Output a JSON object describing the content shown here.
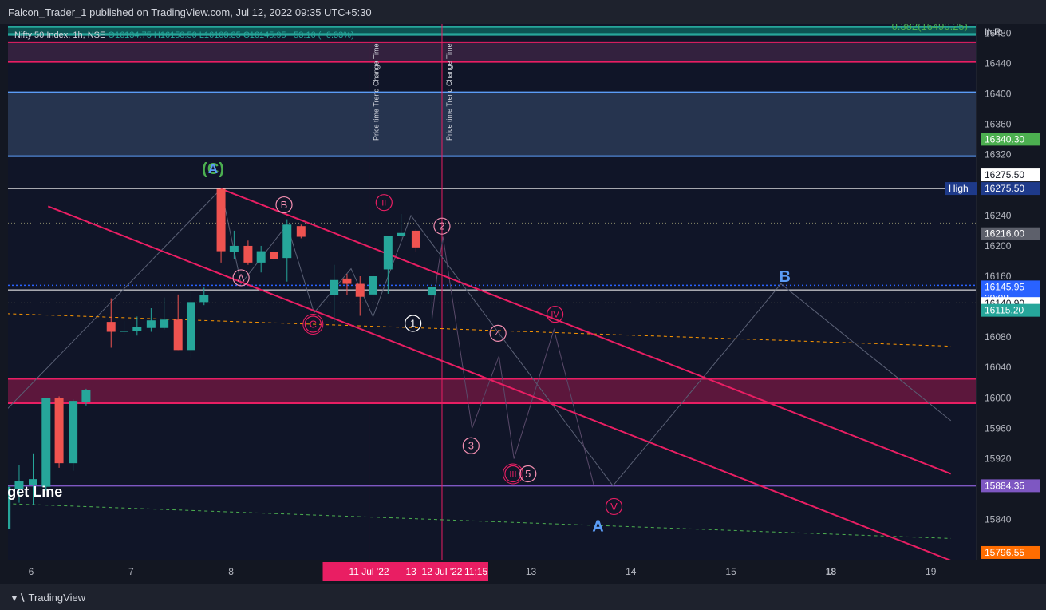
{
  "header": {
    "title": "Falcon_Trader_1 published on TradingView.com, Jul 12, 2022 09:35 UTC+5:30"
  },
  "footer": {
    "brand": "TradingView",
    "brand_icon": "tradingview-logo-icon"
  },
  "colors": {
    "bg": "#131722",
    "up": "#26a69a",
    "down": "#ef5350",
    "pink": "#e91e63",
    "blue_line": "#5b9cf6",
    "purple": "#7e57c2",
    "orange": "#ff9800",
    "green_label": "#4caf50"
  },
  "chart_data": {
    "type": "candlestick",
    "symbol_line": {
      "name": "Nifty 50 Index, 1h, NSE",
      "open": "O16134.75",
      "high": "H16150.50",
      "low": "L16103.35",
      "close": "C16145.95",
      "change": "−53.10 (−0.33%)"
    },
    "currency": "INR",
    "y_range": [
      15786,
      16492
    ],
    "y_ticks": [
      16480,
      16440,
      16400,
      16360,
      16320,
      16240,
      16200,
      16160,
      16080,
      16040,
      16000,
      15960,
      15920,
      15840
    ],
    "x_ticks": [
      {
        "label": "6",
        "x": 0.5
      },
      {
        "label": "7",
        "x": 1.5
      },
      {
        "label": "8",
        "x": 2.5
      },
      {
        "label": "11",
        "x": 3.5,
        "bold": true
      },
      {
        "label": "13",
        "x": 5.5
      },
      {
        "label": "14",
        "x": 6.5
      },
      {
        "label": "15",
        "x": 7.5
      },
      {
        "label": "18",
        "x": 8.5,
        "bold": true
      },
      {
        "label": "19",
        "x": 9.5
      }
    ],
    "x_highlight": [
      {
        "label": "11 Jul '22",
        "x": 3.88
      },
      {
        "label": "13",
        "x": 4.3
      },
      {
        "label": "12 Jul '22",
        "x": 4.61
      },
      {
        "label": "11:15",
        "x": 4.95
      }
    ],
    "candles": [
      {
        "x": 0.12,
        "o": 15806,
        "h": 15820,
        "l": 15790,
        "c": 15795
      },
      {
        "x": 0.25,
        "o": 15828,
        "h": 15897,
        "l": 15796,
        "c": 15883
      },
      {
        "x": 0.38,
        "o": 15880,
        "h": 15912,
        "l": 15862,
        "c": 15890
      },
      {
        "x": 0.52,
        "o": 15885,
        "h": 15927,
        "l": 15859,
        "c": 15893
      },
      {
        "x": 0.65,
        "o": 15883,
        "h": 16000,
        "l": 15878,
        "c": 16000
      },
      {
        "x": 0.78,
        "o": 16000,
        "h": 16002,
        "l": 15908,
        "c": 15914
      },
      {
        "x": 0.92,
        "o": 15914,
        "h": 15998,
        "l": 15904,
        "c": 15996
      },
      {
        "x": 1.05,
        "o": 15995,
        "h": 16012,
        "l": 15990,
        "c": 16010
      },
      {
        "x": 1.3,
        "o": 16100,
        "h": 16131,
        "l": 16066,
        "c": 16087
      },
      {
        "x": 1.43,
        "o": 16087,
        "h": 16101,
        "l": 16082,
        "c": 16088
      },
      {
        "x": 1.56,
        "o": 16088,
        "h": 16107,
        "l": 16082,
        "c": 16093
      },
      {
        "x": 1.7,
        "o": 16092,
        "h": 16118,
        "l": 16087,
        "c": 16102
      },
      {
        "x": 1.83,
        "o": 16092,
        "h": 16132,
        "l": 16090,
        "c": 16103
      },
      {
        "x": 1.97,
        "o": 16103,
        "h": 16136,
        "l": 16063,
        "c": 16063
      },
      {
        "x": 2.1,
        "o": 16063,
        "h": 16140,
        "l": 16052,
        "c": 16126
      },
      {
        "x": 2.23,
        "o": 16126,
        "h": 16145,
        "l": 16122,
        "c": 16135
      },
      {
        "x": 2.4,
        "o": 16275,
        "h": 16275,
        "l": 16178,
        "c": 16193
      },
      {
        "x": 2.53,
        "o": 16192,
        "h": 16220,
        "l": 16183,
        "c": 16200
      },
      {
        "x": 2.67,
        "o": 16200,
        "h": 16207,
        "l": 16175,
        "c": 16178
      },
      {
        "x": 2.8,
        "o": 16178,
        "h": 16200,
        "l": 16165,
        "c": 16193
      },
      {
        "x": 2.93,
        "o": 16192,
        "h": 16205,
        "l": 16180,
        "c": 16183
      },
      {
        "x": 3.06,
        "o": 16184,
        "h": 16235,
        "l": 16153,
        "c": 16228
      },
      {
        "x": 3.2,
        "o": 16226,
        "h": 16228,
        "l": 16210,
        "c": 16212
      },
      {
        "x": 3.53,
        "o": 16135,
        "h": 16175,
        "l": 16100,
        "c": 16155
      },
      {
        "x": 3.66,
        "o": 16157,
        "h": 16163,
        "l": 16135,
        "c": 16150
      },
      {
        "x": 3.79,
        "o": 16150,
        "h": 16160,
        "l": 16108,
        "c": 16133
      },
      {
        "x": 3.92,
        "o": 16136,
        "h": 16165,
        "l": 16107,
        "c": 16160
      },
      {
        "x": 4.07,
        "o": 16169,
        "h": 16213,
        "l": 16137,
        "c": 16213
      },
      {
        "x": 4.2,
        "o": 16213,
        "h": 16242,
        "l": 16210,
        "c": 16217
      },
      {
        "x": 4.35,
        "o": 16220,
        "h": 16222,
        "l": 16192,
        "c": 16198
      },
      {
        "x": 4.51,
        "o": 16134.75,
        "h": 16150.5,
        "l": 16103.35,
        "c": 16145.95
      }
    ],
    "price_labels": [
      {
        "value": 16340.3,
        "text": "16340.30",
        "bg": "#4caf50",
        "fg": "#ffffff"
      },
      {
        "value": 16275.5,
        "text": "16275.50",
        "bg": "#ffffff",
        "fg": "#131722",
        "offset": -17
      },
      {
        "value": 16275.5,
        "text": "16275.50",
        "bg": "#1e3a8a",
        "fg": "#ffffff",
        "tag": "High"
      },
      {
        "value": 16216.0,
        "text": "16216.00",
        "bg": "#5d606b",
        "fg": "#ffffff"
      },
      {
        "value": 16145.95,
        "text": "16145.95",
        "bg": "#2962ff",
        "fg": "#ffffff",
        "sub": "39:08"
      },
      {
        "value": 16140.9,
        "text": "16140.90",
        "bg": "#ffffff",
        "fg": "#131722",
        "offset": 16
      },
      {
        "value": 16115.2,
        "text": "16115.20",
        "bg": "#26a69a",
        "fg": "#ffffff"
      },
      {
        "value": 15884.35,
        "text": "15884.35",
        "bg": "#7e57c2",
        "fg": "#ffffff"
      },
      {
        "value": 15796.55,
        "text": "15796.55",
        "bg": "#ff6d00",
        "fg": "#ffffff"
      }
    ],
    "fib_label": "0.382(16490.25)",
    "fib_line": 16490.25,
    "zones": [
      {
        "top": 16488,
        "bottom": 16479,
        "fill": "#0d5e5a",
        "stroke": "#26a69a"
      },
      {
        "top": 16468,
        "bottom": 16442,
        "fill": "#3a2342",
        "stroke": "#e91e63"
      },
      {
        "top": 16402,
        "bottom": 16318,
        "fill": "#2a3a56",
        "stroke": "#5b9cf6"
      },
      {
        "top": 16025,
        "bottom": 15993,
        "fill": "#6a1740",
        "stroke": "#e91e63"
      }
    ],
    "hlines": [
      {
        "value": 16275.5,
        "color": "#ffffff",
        "dash": "",
        "width": 1
      },
      {
        "value": 16230,
        "color": "#8a8a6a",
        "dash": "1,3",
        "width": 1
      },
      {
        "value": 16148,
        "color": "#2962ff",
        "dash": "2,3",
        "width": 1.5
      },
      {
        "value": 16142,
        "color": "#ffffff",
        "dash": "",
        "width": 1
      },
      {
        "value": 16125,
        "color": "#8a8a6a",
        "dash": "1,3",
        "width": 1
      },
      {
        "value": 15884.35,
        "color": "#7e57c2",
        "dash": "",
        "width": 2
      }
    ],
    "diag_lines": [
      {
        "x1": 0.0,
        "y1": 16112,
        "x2": 9.7,
        "y2": 16068,
        "color": "#ff9800",
        "dash": "4,4",
        "width": 1
      },
      {
        "x1": 0.0,
        "y1": 15862,
        "x2": 9.7,
        "y2": 15815,
        "color": "#4caf50",
        "dash": "4,4",
        "width": 1
      },
      {
        "x1": 2.4,
        "y1": 16275,
        "x2": 9.7,
        "y2": 15900,
        "color": "#e91e63",
        "dash": "",
        "width": 2
      },
      {
        "x1": 0.67,
        "y1": 16252,
        "x2": 9.7,
        "y2": 15786,
        "color": "#e91e63",
        "dash": "",
        "width": 2
      }
    ],
    "paths": [
      {
        "color": "#5a6075",
        "points": [
          [
            0.0,
            15950
          ],
          [
            2.4,
            16275
          ],
          [
            2.6,
            16150
          ],
          [
            3.06,
            16228
          ],
          [
            3.33,
            16112
          ],
          [
            3.7,
            16170
          ],
          [
            3.92,
            16107
          ],
          [
            4.3,
            16240
          ],
          [
            6.32,
            15884.35
          ],
          [
            8.0,
            16150
          ],
          [
            9.7,
            15970
          ]
        ]
      },
      {
        "color": "#5a4a6a",
        "points": [
          [
            4.51,
            16104
          ],
          [
            4.56,
            16160
          ],
          [
            4.62,
            16212
          ],
          [
            4.91,
            15960
          ],
          [
            5.18,
            16055
          ],
          [
            5.33,
            15920
          ],
          [
            5.73,
            16090
          ],
          [
            6.13,
            15884.35
          ]
        ]
      }
    ],
    "vlines": [
      {
        "x": 3.88,
        "label": "Price time Trend Change Time"
      },
      {
        "x": 4.61,
        "label": "Price time Trend Change Time"
      }
    ],
    "wave_labels": [
      {
        "x": 2.32,
        "y": 16300,
        "text": "(C)",
        "color": "#4caf50",
        "style": "plain",
        "size": 20
      },
      {
        "x": 2.32,
        "y": 16300,
        "text": "A",
        "color": "#5b9cf6",
        "style": "plain",
        "size": 17
      },
      {
        "x": 3.03,
        "y": 16254,
        "text": "B",
        "color": "#f48fb1",
        "style": "circle"
      },
      {
        "x": 2.6,
        "y": 16158,
        "text": "A",
        "color": "#f48fb1",
        "style": "circle"
      },
      {
        "x": 3.32,
        "y": 16097,
        "text": "C",
        "color": "#e91e63",
        "style": "circle-double"
      },
      {
        "x": 4.03,
        "y": 16257,
        "text": "II",
        "color": "#e91e63",
        "style": "circle"
      },
      {
        "x": 4.61,
        "y": 16226,
        "text": "2",
        "color": "#f48fb1",
        "style": "circle"
      },
      {
        "x": 4.32,
        "y": 16098,
        "text": "1",
        "color": "#ffffff",
        "style": "circle"
      },
      {
        "x": 5.17,
        "y": 16085,
        "text": "4",
        "color": "#f48fb1",
        "style": "circle"
      },
      {
        "x": 5.74,
        "y": 16110,
        "text": "IV",
        "color": "#e91e63",
        "style": "circle"
      },
      {
        "x": 4.9,
        "y": 15937,
        "text": "3",
        "color": "#f48fb1",
        "style": "circle"
      },
      {
        "x": 5.32,
        "y": 15900,
        "text": "III",
        "color": "#e91e63",
        "style": "circle-double"
      },
      {
        "x": 5.47,
        "y": 15900,
        "text": "5",
        "color": "#f48fb1",
        "style": "circle"
      },
      {
        "x": 6.33,
        "y": 15857,
        "text": "V",
        "color": "#e91e63",
        "style": "circle"
      },
      {
        "x": 6.17,
        "y": 15830,
        "text": "A",
        "color": "#5b9cf6",
        "style": "plain",
        "size": 20
      },
      {
        "x": 8.04,
        "y": 16158,
        "text": "B",
        "color": "#5b9cf6",
        "style": "plain",
        "size": 20
      }
    ],
    "annotations": [
      {
        "x": 0.05,
        "y": 15870,
        "text": "Target Line",
        "color": "#ffffff",
        "size": 18,
        "bold": true
      }
    ]
  }
}
